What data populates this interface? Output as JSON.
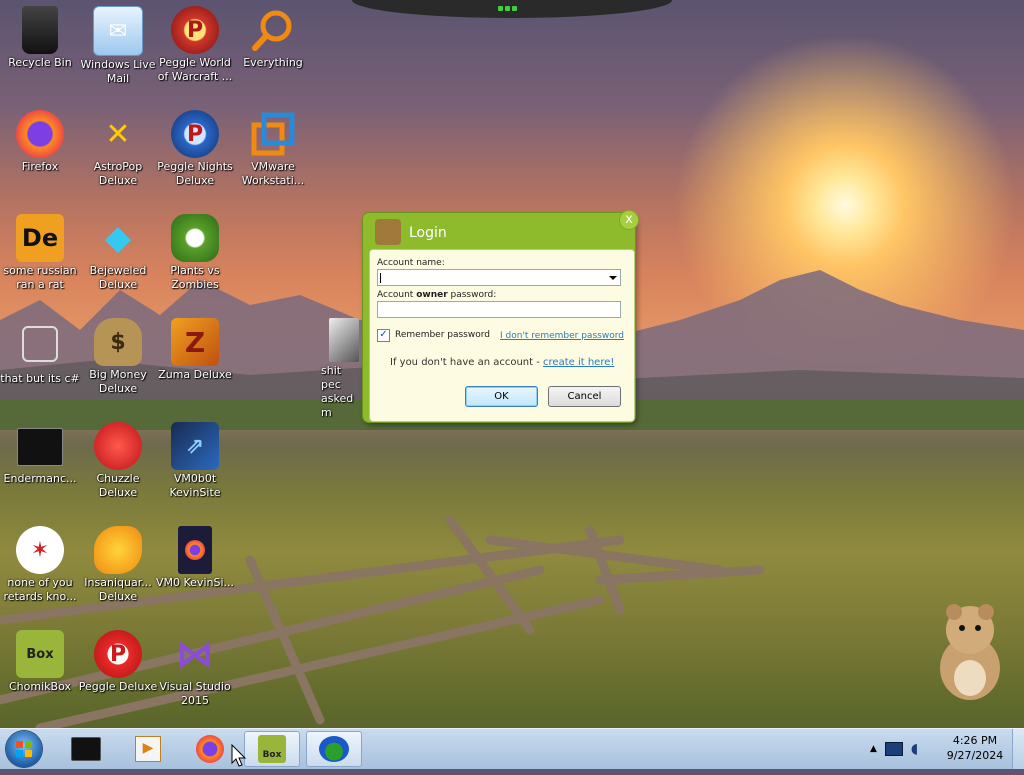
{
  "desktop": {
    "icons": [
      {
        "label": "Recycle Bin",
        "icon": "recycle-bin-icon"
      },
      {
        "label": "Windows Live Mail",
        "icon": "mail-icon"
      },
      {
        "label": "Peggle World of Warcraft ...",
        "icon": "peggle-icon"
      },
      {
        "label": "Everything",
        "icon": "search-icon"
      },
      {
        "label": "Firefox",
        "icon": "firefox-icon"
      },
      {
        "label": "AstroPop Deluxe",
        "icon": "astropop-icon"
      },
      {
        "label": "Peggle Nights Deluxe",
        "icon": "peggle-nights-icon"
      },
      {
        "label": "VMware Workstati...",
        "icon": "vmware-icon"
      },
      {
        "label": "some russian ran a rat",
        "icon": "de-icon"
      },
      {
        "label": "Bejeweled Deluxe",
        "icon": "gem-icon"
      },
      {
        "label": "Plants vs Zombies",
        "icon": "plant-icon"
      },
      {
        "label": "that but its c#",
        "icon": "window-stack-icon"
      },
      {
        "label": "Big Money Deluxe",
        "icon": "money-bag-icon"
      },
      {
        "label": "Zuma Deluxe",
        "icon": "zuma-icon"
      },
      {
        "label": "shit pec asked m",
        "icon": "file-icon"
      },
      {
        "label": "Endermanc...",
        "icon": "terminal-icon"
      },
      {
        "label": "Chuzzle Deluxe",
        "icon": "chuzzle-icon"
      },
      {
        "label": "VM0b0t KevinSite",
        "icon": "shortcut-icon"
      },
      {
        "label": "none of you retards kno...",
        "icon": "dragon-icon"
      },
      {
        "label": "Insaniquar... Deluxe",
        "icon": "fish-icon"
      },
      {
        "label": "VM0 KevinSi...",
        "icon": "firefox-file-icon"
      },
      {
        "label": "ChomikBox",
        "icon": "chomikbox-icon"
      },
      {
        "label": "Peggle Deluxe",
        "icon": "peggle-icon"
      },
      {
        "label": "Visual Studio 2015",
        "icon": "visual-studio-icon"
      }
    ]
  },
  "dialog": {
    "title": "Login",
    "close_glyph": "x",
    "account_label": "Account name:",
    "account_value": "",
    "password_label_pre": "Account ",
    "password_label_bold": "owner",
    "password_label_post": " password:",
    "password_value": "",
    "remember_label": "Remember password",
    "remember_checked": true,
    "forgot_link": "I don't remember password",
    "no_account_text": "If you don't have an account - ",
    "create_link": "create it here!",
    "ok_label": "OK",
    "cancel_label": "Cancel"
  },
  "taskbar": {
    "time": "4:26 PM",
    "date": "9/27/2024",
    "tray_icons": [
      "show-hidden-icons-chevron",
      "network-icon",
      "volume-icon"
    ]
  },
  "colors": {
    "dialog_green": "#8dbb2c",
    "dialog_body": "#fdfbe1",
    "link": "#2a7cc0"
  }
}
